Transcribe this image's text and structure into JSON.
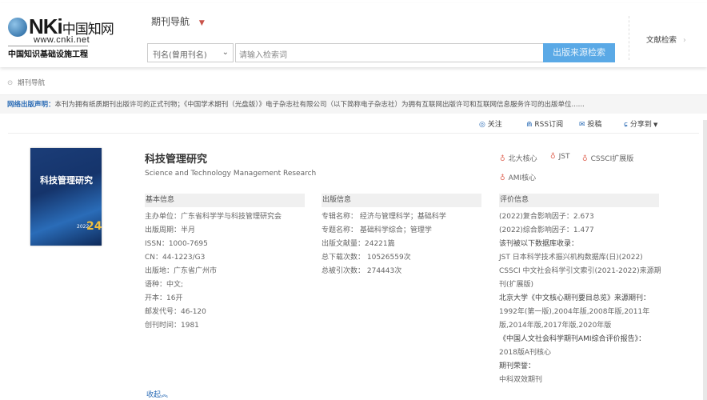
{
  "header": {
    "logo_url": "www.cnki.net",
    "logo_tagline": "中国知识基础设施工程",
    "logo_text": "CNKI中国知网",
    "nav_title": "期刊导航",
    "search_field": "刊名(曾用刊名)",
    "search_placeholder": "请输入检索词",
    "search_button": "出版来源检索",
    "right_link": "文献检索"
  },
  "breadcrumb": "期刊导航",
  "notice": {
    "label": "网络出版声明：",
    "text": "本刊为拥有纸质期刊出版许可的正式刊物；《中国学术期刊（光盘版）》电子杂志社有限公司（以下简称电子杂志社）为拥有互联网出版许可和互联网信息服务许可的出版单位......"
  },
  "actions": {
    "follow": "关注",
    "rss": "RSS订阅",
    "submit": "投稿",
    "share": "分享到"
  },
  "journal": {
    "title": "科技管理研究",
    "subtitle": "Science and Technology Management Research",
    "cover_title": "科技管理研究",
    "cover_issue": "24",
    "cover_year": "2022"
  },
  "badges": [
    "北大核心",
    "JST",
    "CSSCI扩展版",
    "AMI核心"
  ],
  "basic": {
    "heading": "基本信息",
    "rows": [
      "主办单位：广东省科学学与科技管理研究会",
      "出版周期：半月",
      "ISSN：1000-7695",
      "CN：44-1223/G3",
      "出版地：广东省广州市",
      "语种：中文;",
      "开本：16开",
      "邮发代号：46-120",
      "创刊时间：1981"
    ]
  },
  "publish": {
    "heading": "出版信息",
    "rows": [
      "专辑名称： 经济与管理科学；基础科学",
      "专题名称： 基础科学综合；管理学",
      "出版文献量：24221篇",
      "总下载次数： 10526559次",
      "总被引次数： 274443次"
    ]
  },
  "eval": {
    "heading": "评价信息",
    "rows": [
      "(2022)复合影响因子：2.673",
      "(2022)综合影响因子：1.477",
      "该刊被以下数据库收录：",
      "JST 日本科学技术振兴机构数据库(日)(2022)",
      "CSSCI 中文社会科学引文索引(2021-2022)来源期",
      "刊(扩展版)",
      "北京大学《中文核心期刊要目总览》来源期刊：",
      "1992年(第一版),2004年版,2008年版,2011年",
      "版,2014年版,2017年版,2020年版",
      "《中国人文社会科学期刊AMI综合评价报告》：",
      "2018版A刊核心",
      "期刊荣誉：",
      "中科双效期刊"
    ]
  },
  "collapse": "收起",
  "colors": {
    "accent": "#5aa9e6",
    "link": "#2a6bb5",
    "badge": "#e06a5a"
  }
}
